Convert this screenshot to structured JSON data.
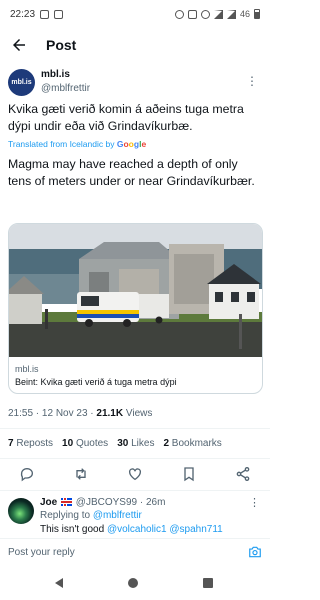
{
  "status_bar": {
    "time": "22:23",
    "battery": "46"
  },
  "header": {
    "title": "Post"
  },
  "post": {
    "author_name": "mbl.is",
    "author_handle": "@mblfrettir",
    "avatar_text": "mbl.is",
    "text": "Kvika gæti verið komin á aðeins tuga metra dýpi undir eða við Grindavíkurbæ.",
    "translated_label": "Translated from Icelandic by",
    "translated_provider": [
      "G",
      "o",
      "o",
      "g",
      "l",
      "e"
    ],
    "translation": "Magma may have reached a depth of only tens of meters under or near Grindavíkurbær.",
    "card": {
      "domain": "mbl.is",
      "title": "Beint: Kvika gæti verið á tuga metra dýpi"
    },
    "time": "21:55",
    "date": "12 Nov 23",
    "views_count": "21.1K",
    "views_label": "Views",
    "stats": [
      {
        "count": "7",
        "label": "Reposts"
      },
      {
        "count": "10",
        "label": "Quotes"
      },
      {
        "count": "30",
        "label": "Likes"
      },
      {
        "count": "2",
        "label": "Bookmarks"
      }
    ]
  },
  "reply": {
    "name": "Joe",
    "handle": "@JBCOYS99",
    "age": "26m",
    "replying_to_label": "Replying to",
    "replying_to_handle": "@mblfrettir",
    "text": "This isn't good",
    "mentions": "@volcaholic1 @spahn711"
  },
  "compose": {
    "placeholder": "Post your reply"
  },
  "colors": {
    "accent": "#1d9bf0",
    "text": "#0f1419",
    "muted": "#536471",
    "avatar": "#1d3a7a"
  },
  "icons": [
    "back-arrow-icon",
    "more-icon",
    "reply-icon",
    "repost-icon",
    "like-icon",
    "bookmark-icon",
    "share-icon",
    "camera-icon"
  ]
}
